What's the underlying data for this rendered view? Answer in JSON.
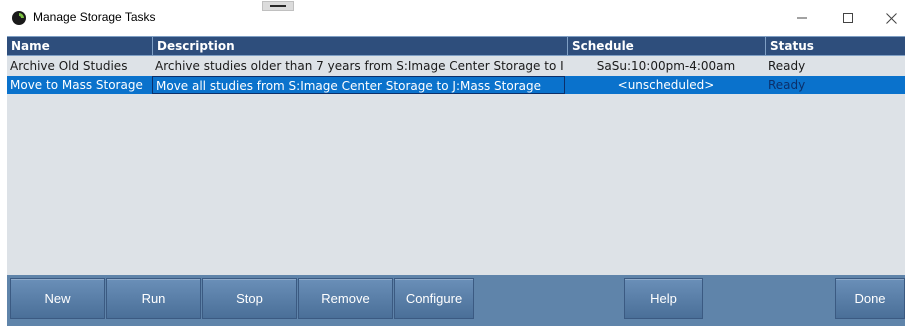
{
  "window": {
    "title": "Manage Storage Tasks"
  },
  "table": {
    "columns": {
      "name": "Name",
      "description": "Description",
      "schedule": "Schedule",
      "status": "Status"
    },
    "rows": [
      {
        "name": "Archive Old Studies",
        "description": "Archive studies older than 7 years from S:Image Center Storage to I",
        "schedule": "SaSu:10:00pm-4:00am",
        "status": "Ready",
        "selected": false
      },
      {
        "name": "Move to Mass Storage",
        "description": "Move all studies from S:Image Center Storage to J:Mass Storage",
        "schedule": "<unscheduled>",
        "status": "Ready",
        "selected": true
      }
    ]
  },
  "buttons": {
    "new": "New",
    "run": "Run",
    "stop": "Stop",
    "remove": "Remove",
    "configure": "Configure",
    "help": "Help",
    "done": "Done"
  },
  "colors": {
    "header_bg": "#2e4e7c",
    "list_bg": "#dde2e7",
    "selection_bg": "#0a72cc",
    "button_bar_bg": "#5f84aa"
  },
  "icons": {
    "app": "app-logo-icon",
    "minimize": "minimize-icon",
    "maximize": "maximize-icon",
    "close": "close-icon"
  }
}
